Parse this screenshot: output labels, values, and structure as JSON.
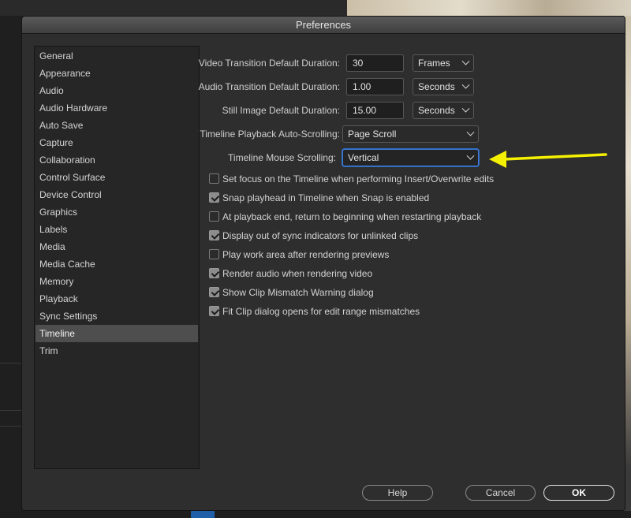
{
  "dialog": {
    "title": "Preferences"
  },
  "sidebar": {
    "items": [
      {
        "label": "General"
      },
      {
        "label": "Appearance"
      },
      {
        "label": "Audio"
      },
      {
        "label": "Audio Hardware"
      },
      {
        "label": "Auto Save"
      },
      {
        "label": "Capture"
      },
      {
        "label": "Collaboration"
      },
      {
        "label": "Control Surface"
      },
      {
        "label": "Device Control"
      },
      {
        "label": "Graphics"
      },
      {
        "label": "Labels"
      },
      {
        "label": "Media"
      },
      {
        "label": "Media Cache"
      },
      {
        "label": "Memory"
      },
      {
        "label": "Playback"
      },
      {
        "label": "Sync Settings"
      },
      {
        "label": "Timeline"
      },
      {
        "label": "Trim"
      }
    ],
    "selected": "Timeline"
  },
  "timeline": {
    "video_transition": {
      "label": "Video Transition Default Duration:",
      "value": "30",
      "unit": "Frames"
    },
    "audio_transition": {
      "label": "Audio Transition Default Duration:",
      "value": "1.00",
      "unit": "Seconds"
    },
    "still_image": {
      "label": "Still Image Default Duration:",
      "value": "15.00",
      "unit": "Seconds"
    },
    "auto_scrolling": {
      "label": "Timeline Playback Auto-Scrolling:",
      "value": "Page Scroll"
    },
    "mouse_scrolling": {
      "label": "Timeline Mouse Scrolling:",
      "value": "Vertical"
    },
    "options": [
      {
        "label": "Set focus on the Timeline when performing Insert/Overwrite edits",
        "checked": false
      },
      {
        "label": "Snap playhead in Timeline when Snap is enabled",
        "checked": true
      },
      {
        "label": "At playback end, return to beginning when restarting playback",
        "checked": false
      },
      {
        "label": "Display out of sync indicators for unlinked clips",
        "checked": true
      },
      {
        "label": "Play work area after rendering previews",
        "checked": false
      },
      {
        "label": "Render audio when rendering video",
        "checked": true
      },
      {
        "label": "Show Clip Mismatch Warning dialog",
        "checked": true
      },
      {
        "label": "Fit Clip dialog opens for edit range mismatches",
        "checked": true
      }
    ]
  },
  "buttons": {
    "help": "Help",
    "cancel": "Cancel",
    "ok": "OK"
  },
  "colors": {
    "arrow": "#f5f000",
    "focus": "#3e7bd6"
  }
}
